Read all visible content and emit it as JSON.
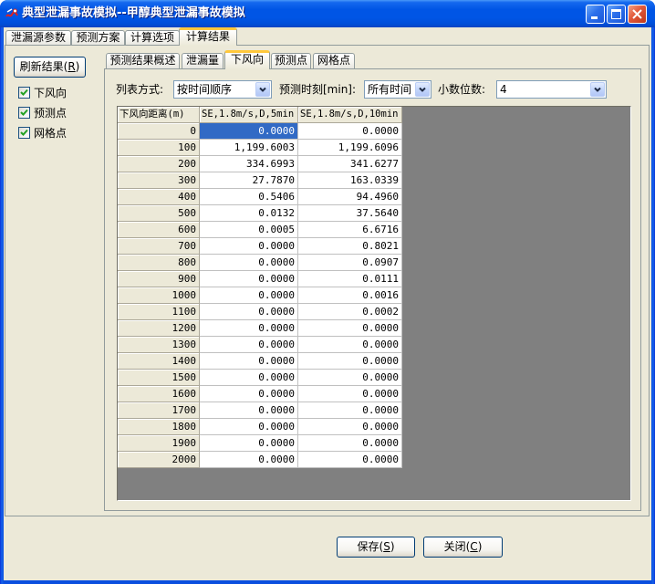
{
  "window": {
    "title": "典型泄漏事故模拟--甲醇典型泄漏事故模拟",
    "icon": "app-icon",
    "buttons": {
      "minimize": "minimize-icon",
      "maximize": "maximize-icon",
      "close": "close-icon"
    }
  },
  "main_tabs": [
    {
      "label": "泄漏源参数",
      "active": false
    },
    {
      "label": "预测方案",
      "active": false
    },
    {
      "label": "计算选项",
      "active": false
    },
    {
      "label": "计算结果",
      "active": true
    }
  ],
  "results_panel": {
    "refresh_button": {
      "text": "刷新结果(",
      "accel": "R",
      "tail": ")"
    },
    "filters": [
      {
        "label": "下风向",
        "checked": true
      },
      {
        "label": "预测点",
        "checked": true
      },
      {
        "label": "网格点",
        "checked": true
      }
    ],
    "sub_tabs": [
      {
        "label": "预测结果概述",
        "active": false
      },
      {
        "label": "泄漏量",
        "active": false
      },
      {
        "label": "下风向",
        "active": true
      },
      {
        "label": "预测点",
        "active": false
      },
      {
        "label": "网格点",
        "active": false
      }
    ],
    "options": {
      "list_mode": {
        "label": "列表方式:",
        "value": "按时间顺序"
      },
      "predict_time": {
        "label": "预测时刻[min]:",
        "value": "所有时间"
      },
      "decimals": {
        "label": "小数位数:",
        "value": "4"
      }
    },
    "grid": {
      "columns": [
        "下风向距离(m)",
        "SE,1.8m/s,D,5min",
        "SE,1.8m/s,D,10min"
      ],
      "rows": [
        [
          "0",
          "0.0000",
          "0.0000"
        ],
        [
          "100",
          "1,199.6003",
          "1,199.6096"
        ],
        [
          "200",
          "334.6993",
          "341.6277"
        ],
        [
          "300",
          "27.7870",
          "163.0339"
        ],
        [
          "400",
          "0.5406",
          "94.4960"
        ],
        [
          "500",
          "0.0132",
          "37.5640"
        ],
        [
          "600",
          "0.0005",
          "6.6716"
        ],
        [
          "700",
          "0.0000",
          "0.8021"
        ],
        [
          "800",
          "0.0000",
          "0.0907"
        ],
        [
          "900",
          "0.0000",
          "0.0111"
        ],
        [
          "1000",
          "0.0000",
          "0.0016"
        ],
        [
          "1100",
          "0.0000",
          "0.0002"
        ],
        [
          "1200",
          "0.0000",
          "0.0000"
        ],
        [
          "1300",
          "0.0000",
          "0.0000"
        ],
        [
          "1400",
          "0.0000",
          "0.0000"
        ],
        [
          "1500",
          "0.0000",
          "0.0000"
        ],
        [
          "1600",
          "0.0000",
          "0.0000"
        ],
        [
          "1700",
          "0.0000",
          "0.0000"
        ],
        [
          "1800",
          "0.0000",
          "0.0000"
        ],
        [
          "1900",
          "0.0000",
          "0.0000"
        ],
        [
          "2000",
          "0.0000",
          "0.0000"
        ]
      ],
      "selected_cell": {
        "row": 0,
        "column": 1
      }
    }
  },
  "footer": {
    "save_button": {
      "text": "保存(",
      "accel": "S",
      "tail": ")"
    },
    "close_button": {
      "text": "关闭(",
      "accel": "C",
      "tail": ")"
    }
  },
  "colors": {
    "titlebar": "#0055E5",
    "selection": "#316AC5",
    "active_tab_accent": "#FFC83C",
    "grid_background": "#808080",
    "window_background": "#ECE9D8"
  }
}
